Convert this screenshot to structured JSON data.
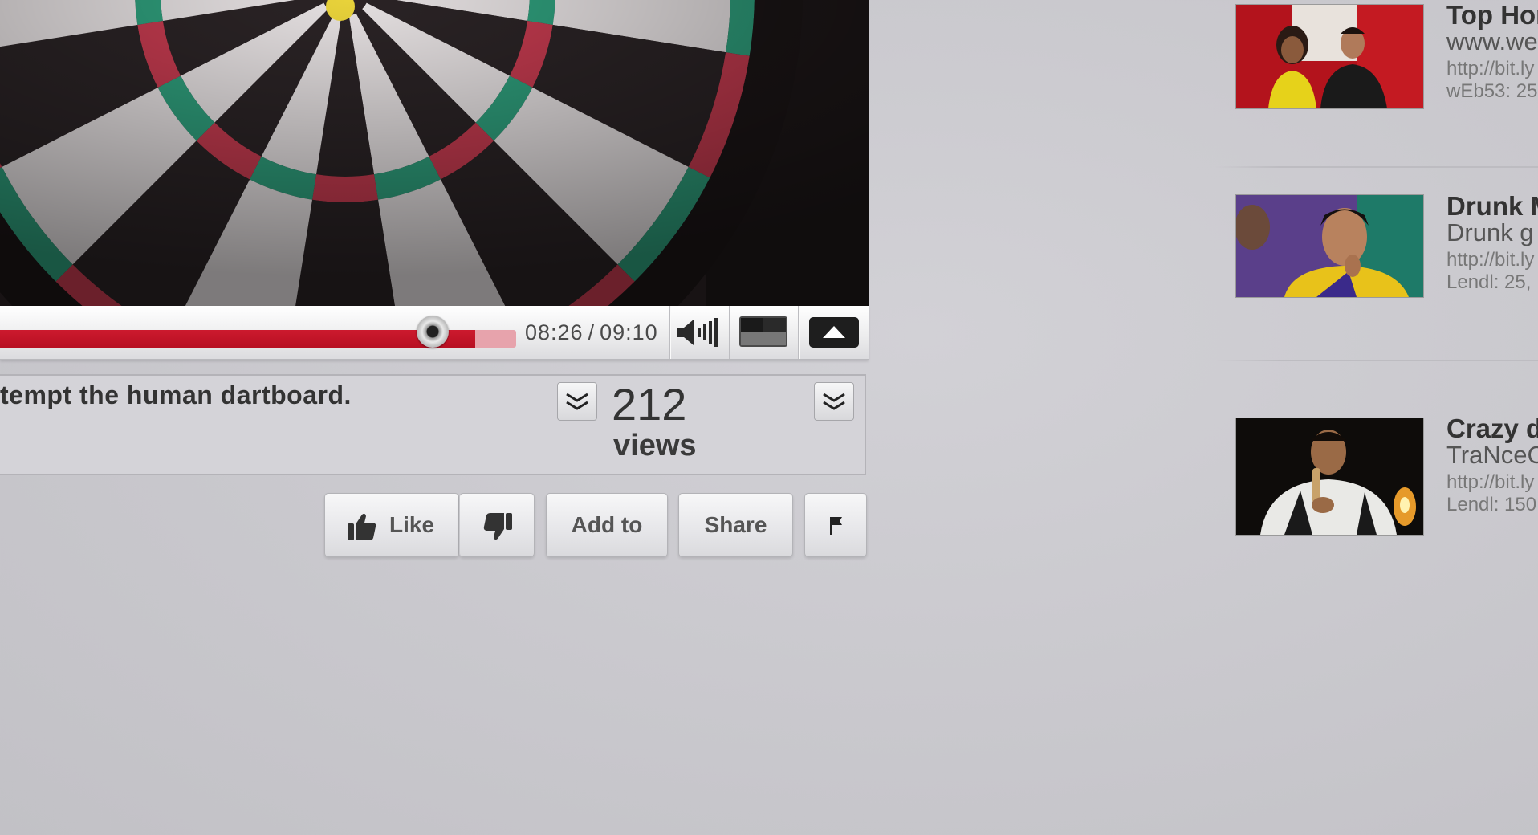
{
  "player": {
    "current_time": "08:26",
    "total_time": "09:10",
    "time_separator": "/",
    "progress_fraction": 0.92,
    "buffered_fraction": 1.0,
    "accent_color": "#cc1a2e"
  },
  "video_info": {
    "description_fragment": "tempt the human dartboard.",
    "view_count": "212",
    "view_label": "views"
  },
  "actions": {
    "like_label": "Like",
    "add_to_label": "Add to",
    "share_label": "Share"
  },
  "icons": {
    "volume": "volume-icon",
    "player_size": "player-size-icon",
    "popout": "popout-icon",
    "expand": "chevron-double-down-icon",
    "like": "thumbs-up-icon",
    "dislike": "thumbs-down-icon",
    "flag": "flag-icon"
  },
  "related_videos": [
    {
      "title": "Top Hor",
      "subtitle": "www.we",
      "url": "http://bit.ly",
      "meta": "wEb53: 25"
    },
    {
      "title": "Drunk M",
      "subtitle": "Drunk g",
      "url": "http://bit.ly",
      "meta": "Lendl: 25,"
    },
    {
      "title": "Crazy d",
      "subtitle": "TraNceC",
      "url": "http://bit.ly",
      "meta": "Lendl: 150"
    }
  ]
}
